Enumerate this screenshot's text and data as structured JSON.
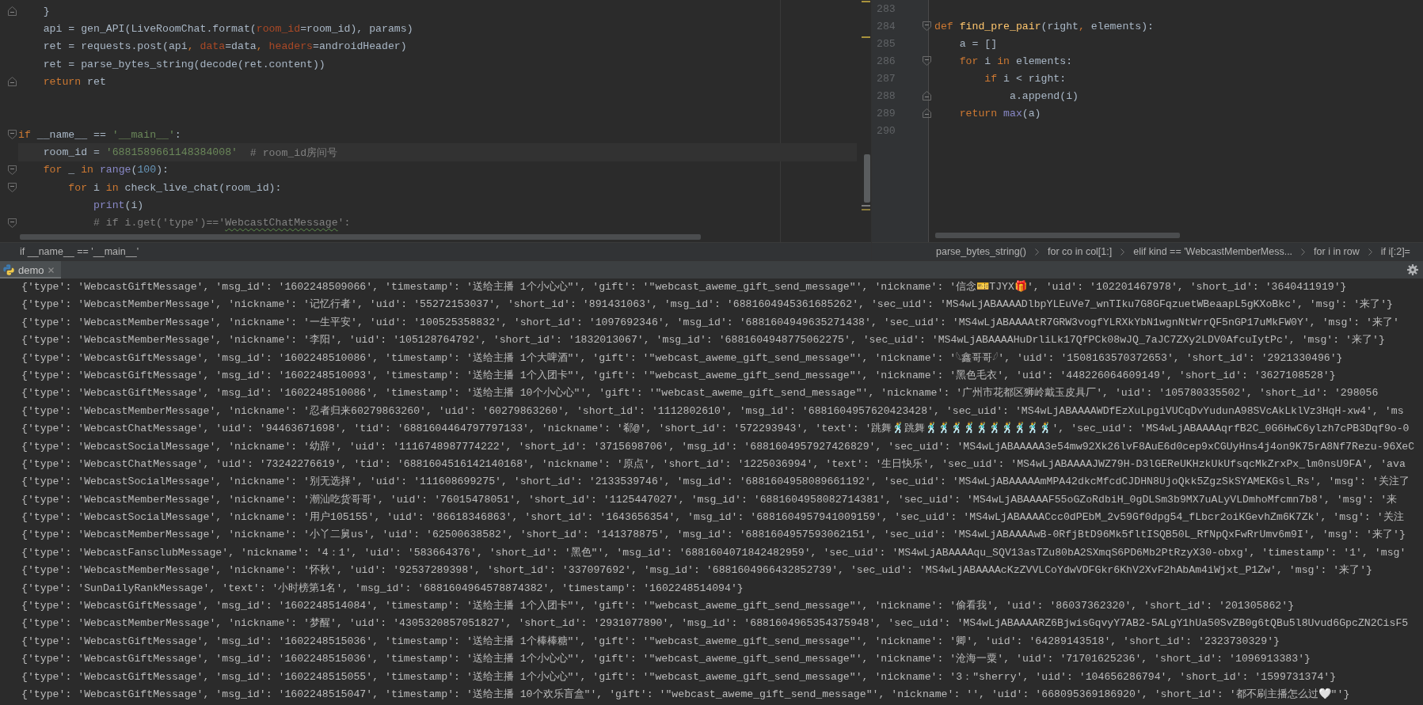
{
  "left_editor": {
    "lines": [
      {
        "kind": "block_end",
        "current": false,
        "tokens": [
          {
            "kind": "plain",
            "text": "    }"
          }
        ]
      },
      {
        "kind": "plain",
        "current": false,
        "tokens": [
          {
            "kind": "plain",
            "text": "    api = gen_API(LiveRoomChat.format("
          },
          {
            "kind": "param",
            "text": "room_id"
          },
          {
            "kind": "plain",
            "text": "=room_id), params)"
          }
        ]
      },
      {
        "kind": "plain",
        "current": false,
        "tokens": [
          {
            "kind": "plain",
            "text": "    ret = requests.post(api"
          },
          {
            "kind": "keyword",
            "text": ", "
          },
          {
            "kind": "param",
            "text": "data"
          },
          {
            "kind": "plain",
            "text": "=data"
          },
          {
            "kind": "keyword",
            "text": ", "
          },
          {
            "kind": "param",
            "text": "headers"
          },
          {
            "kind": "plain",
            "text": "=androidHeader)"
          }
        ]
      },
      {
        "kind": "plain",
        "current": false,
        "tokens": [
          {
            "kind": "plain",
            "text": "    ret = parse_bytes_string(decode(ret.content))"
          }
        ]
      },
      {
        "kind": "block_end",
        "current": false,
        "tokens": [
          {
            "kind": "keyword",
            "text": "    return"
          },
          {
            "kind": "plain",
            "text": " ret"
          }
        ]
      },
      {
        "kind": "plain",
        "current": false
      },
      {
        "kind": "plain",
        "current": false
      },
      {
        "kind": "block_start",
        "current": false,
        "tokens": [
          {
            "kind": "keyword",
            "text": "if"
          },
          {
            "kind": "plain",
            "text": " __name__ == "
          },
          {
            "kind": "string",
            "text": "'__main__'"
          },
          {
            "kind": "plain",
            "text": ":"
          }
        ]
      },
      {
        "kind": "plain",
        "current": true,
        "tokens": [
          {
            "kind": "plain",
            "text": "    room_id = "
          },
          {
            "kind": "string",
            "text": "'6881589661148384008'"
          },
          {
            "kind": "comment",
            "text": "  # room_id房间号"
          }
        ]
      },
      {
        "kind": "block_start",
        "current": false,
        "tokens": [
          {
            "kind": "keyword",
            "text": "    for"
          },
          {
            "kind": "plain",
            "text": " _ "
          },
          {
            "kind": "keyword",
            "text": "in"
          },
          {
            "kind": "builtin",
            "text": " range"
          },
          {
            "kind": "plain",
            "text": "("
          },
          {
            "kind": "number",
            "text": "100"
          },
          {
            "kind": "plain",
            "text": "):"
          }
        ]
      },
      {
        "kind": "block_start",
        "current": false,
        "tokens": [
          {
            "kind": "keyword",
            "text": "        for"
          },
          {
            "kind": "plain",
            "text": " i "
          },
          {
            "kind": "keyword",
            "text": "in"
          },
          {
            "kind": "plain",
            "text": " check_live_chat(room_id):"
          }
        ]
      },
      {
        "kind": "plain",
        "current": false,
        "tokens": [
          {
            "kind": "builtin",
            "text": "            print"
          },
          {
            "kind": "plain",
            "text": "(i)"
          }
        ]
      },
      {
        "kind": "block_start",
        "current": false,
        "tokens": [
          {
            "kind": "comment",
            "text": "            # if i.get('type')=='"
          },
          {
            "kind": "typo",
            "text": "WebcastChatMessage"
          },
          {
            "kind": "comment",
            "text": "':"
          }
        ]
      }
    ],
    "breadcrumbs": [
      "if __name__ == '__main__'"
    ]
  },
  "right_editor": {
    "lines": [
      {
        "kind": "plain",
        "number": "283"
      },
      {
        "kind": "block_start",
        "number": "284",
        "tokens": [
          {
            "kind": "keyword",
            "text": "def"
          },
          {
            "kind": "function",
            "text": " find_pre_pair"
          },
          {
            "kind": "plain",
            "text": "(right"
          },
          {
            "kind": "keyword",
            "text": ", "
          },
          {
            "kind": "plain",
            "text": "elements):"
          }
        ]
      },
      {
        "kind": "plain",
        "number": "285",
        "tokens": [
          {
            "kind": "plain",
            "text": "    a = []"
          }
        ]
      },
      {
        "kind": "block_start",
        "number": "286",
        "tokens": [
          {
            "kind": "keyword",
            "text": "    for"
          },
          {
            "kind": "plain",
            "text": " i "
          },
          {
            "kind": "keyword",
            "text": "in"
          },
          {
            "kind": "plain",
            "text": " elements:"
          }
        ]
      },
      {
        "kind": "plain",
        "number": "287",
        "tokens": [
          {
            "kind": "keyword",
            "text": "        if"
          },
          {
            "kind": "plain",
            "text": " i < right:"
          }
        ]
      },
      {
        "kind": "block_end",
        "number": "288",
        "tokens": [
          {
            "kind": "plain",
            "text": "            a.append(i)"
          }
        ]
      },
      {
        "kind": "block_end",
        "number": "289",
        "tokens": [
          {
            "kind": "keyword",
            "text": "    return"
          },
          {
            "kind": "builtin",
            "text": " max"
          },
          {
            "kind": "plain",
            "text": "(a)"
          }
        ]
      },
      {
        "kind": "plain",
        "number": "290"
      }
    ],
    "breadcrumbs": [
      "parse_bytes_string()",
      "for co in col[1:]",
      "elif kind == 'WebcastMemberMess...",
      "for i in row",
      "if i[:2]="
    ]
  },
  "console": {
    "tab": {
      "label": "demo",
      "selected": true
    },
    "lines": [
      "{'type': 'WebcastGiftMessage', 'msg_id': '1602248509066', 'timestamp': '送给主播 1个小心心\"', 'gift': '\"webcast_aweme_gift_send_message\"', 'nickname': '信念🎫TJYX🎁', 'uid': '102201467978', 'short_id': '3640411919'}",
      "{'type': 'WebcastMemberMessage', 'nickname': '记忆行者', 'uid': '55272153037', 'short_id': '891431063', 'msg_id': '6881604945361685262', 'sec_uid': 'MS4wLjABAAAADlbpYLEuVe7_wnTIku7G8GFqzuetWBeaapL5gKXoBkc', 'msg': '来了'}",
      "{'type': 'WebcastMemberMessage', 'nickname': '一生平安', 'uid': '100525358832', 'short_id': '1097692346', 'msg_id': '6881604949635271438', 'sec_uid': 'MS4wLjABAAAAtR7GRW3vogfYLRXkYbN1wgnNtWrrQF5nGP17uMkFW0Y', 'msg': '来了'",
      "{'type': 'WebcastMemberMessage', 'nickname': '李阳', 'uid': '105128764792', 'short_id': '1832013067', 'msg_id': '6881604948775062275', 'sec_uid': 'MS4wLjABAAAAHuDrliLk17QfPCk08wJQ_7aJC7ZXy2LDV0AfcuIytPc', 'msg': '来了'}",
      "{'type': 'WebcastGiftMessage', 'msg_id': '1602248510086', 'timestamp': '送给主播 1个大啤酒\"', 'gift': '\"webcast_aweme_gift_send_message\"', 'nickname': '𓆩鑫哥哥𓆪', 'uid': '1508163570372653', 'short_id': '2921330496'}",
      "{'type': 'WebcastGiftMessage', 'msg_id': '1602248510093', 'timestamp': '送给主播 1个入团卡\"', 'gift': '\"webcast_aweme_gift_send_message\"', 'nickname': '黑色毛衣', 'uid': '448226064609149', 'short_id': '3627108528'}",
      "{'type': 'WebcastGiftMessage', 'msg_id': '1602248510086', 'timestamp': '送给主播 10个小心心\"', 'gift': '\"webcast_aweme_gift_send_message\"', 'nickname': '广州市花都区狮岭戴玉皮具厂', 'uid': '105780335502', 'short_id': '298056",
      "{'type': 'WebcastMemberMessage', 'nickname': '忍者归来60279863260', 'uid': '60279863260', 'short_id': '1112802610', 'msg_id': '6881604957620423428', 'sec_uid': 'MS4wLjABAAAAWDfEzXuLpgiVUCqDvYudunA98SVcAkLklVz3HqH-xw4', 'ms",
      "{'type': 'WebcastChatMessage', 'uid': '94463671698', 'tid': '6881604464797797133', 'nickname': '郗@', 'short_id': '572293943', 'text': '跳舞🕺跳舞🕺🕺🕺🕺🕺🕺🕺🕺🕺🕺', 'sec_uid': 'MS4wLjABAAAAqrfB2C_0G6HwC6ylzh7cPB3Dqf9o-0",
      "{'type': 'WebcastSocialMessage', 'nickname': '幼辞', 'uid': '1116748987774222', 'short_id': '3715698706', 'msg_id': '6881604957927426829', 'sec_uid': 'MS4wLjABAAAAA3e54mw92Xk26lvF8AuE6d0cep9xCGUyHns4j4on9K75rA8Nf7Rezu-96XeC",
      "{'type': 'WebcastChatMessage', 'uid': '73242276619', 'tid': '6881604516142140168', 'nickname': '原点', 'short_id': '1225036994', 'text': '生日快乐', 'sec_uid': 'MS4wLjABAAAAJWZ79H-D3lGEReUKHzkUkUfsqcMkZrxPx_lm0nsU9FA', 'ava",
      "{'type': 'WebcastSocialMessage', 'nickname': '别无选择', 'uid': '111608699275', 'short_id': '2133539746', 'msg_id': '6881604958089661192', 'sec_uid': 'MS4wLjABAAAAAmMPA42dkcMfcdCJDHN8UjoQkk5ZgzSkSYAMEKGsl_Rs', 'msg': '关注了",
      "{'type': 'WebcastMemberMessage', 'nickname': '潮汕吃货哥哥', 'uid': '76015478051', 'short_id': '1125447027', 'msg_id': '6881604958082714381', 'sec_uid': 'MS4wLjABAAAAF55oGZoRdbiH_0gDLSm3b9MX7uALyVLDmhoMfcmn7b8', 'msg': '来",
      "{'type': 'WebcastSocialMessage', 'nickname': '用户105155', 'uid': '86618346863', 'short_id': '1643656354', 'msg_id': '6881604957941009159', 'sec_uid': 'MS4wLjABAAAACcc0dPEbM_2v59Gf0dpg54_fLbcr2oiKGevhZm6K7Zk', 'msg': '关注",
      "{'type': 'WebcastMemberMessage', 'nickname': '小丫二舅us', 'uid': '62500638582', 'short_id': '141378875', 'msg_id': '6881604957593062151', 'sec_uid': 'MS4wLjABAAAAwB-0RfjBtD96Mk5fltISQB50L_RfNpQxFwRrUmv6m9I', 'msg': '来了'}",
      "{'type': 'WebcastFansclubMessage', 'nickname': '4：1', 'uid': '583664376', 'short_id': '黑色\"', 'msg_id': '6881604071842482959', 'sec_uid': 'MS4wLjABAAAAqu_SQV13asTZu80bA2SXmqS6PD6Mb2PtRzyX30-obxg', 'timestamp': '1', 'msg'",
      "{'type': 'WebcastMemberMessage', 'nickname': '怀秋', 'uid': '92537289398', 'short_id': '337097692', 'msg_id': '6881604966432852739', 'sec_uid': 'MS4wLjABAAAAcKzZVVLCoYdwVDFGkr6KhV2XvF2hAbAm4iWjxt_P1Zw', 'msg': '来了'}",
      "{'type': 'SunDailyRankMessage', 'text': '小时榜第1名', 'msg_id': '6881604964578874382', 'timestamp': '1602248514094'}",
      "{'type': 'WebcastGiftMessage', 'msg_id': '1602248514084', 'timestamp': '送给主播 1个入团卡\"', 'gift': '\"webcast_aweme_gift_send_message\"', 'nickname': '偷看我', 'uid': '86037362320', 'short_id': '201305862'}",
      "{'type': 'WebcastMemberMessage', 'nickname': '梦醒', 'uid': '4305320857051827', 'short_id': '2931077890', 'msg_id': '6881604965354375948', 'sec_uid': 'MS4wLjABAAAARZ6BjwisGqvyY7AB2-5ALgY1hUa50SvZB0g6tQBu5l8Uvud6GpcZN2CisF5",
      "{'type': 'WebcastGiftMessage', 'msg_id': '1602248515036', 'timestamp': '送给主播 1个棒棒糖\"', 'gift': '\"webcast_aweme_gift_send_message\"', 'nickname': '卿', 'uid': '64289143518', 'short_id': '2323730329'}",
      "{'type': 'WebcastGiftMessage', 'msg_id': '1602248515036', 'timestamp': '送给主播 1个小心心\"', 'gift': '\"webcast_aweme_gift_send_message\"', 'nickname': '沧海一粟', 'uid': '71701625236', 'short_id': '1096913383'}",
      "{'type': 'WebcastGiftMessage', 'msg_id': '1602248515055', 'timestamp': '送给主播 1个小心心\"', 'gift': '\"webcast_aweme_gift_send_message\"', 'nickname': '3：\"sherry', 'uid': '104656286794', 'short_id': '1599731374'}",
      "{'type': 'WebcastGiftMessage', 'msg_id': '1602248515047', 'timestamp': '送给主播 10个欢乐盲盒\"', 'gift': '\"webcast_aweme_gift_send_message\"', 'nickname': '', 'uid': '668095369186920', 'short_id': '都不刷主播怎么过🤍\"'}"
    ]
  }
}
